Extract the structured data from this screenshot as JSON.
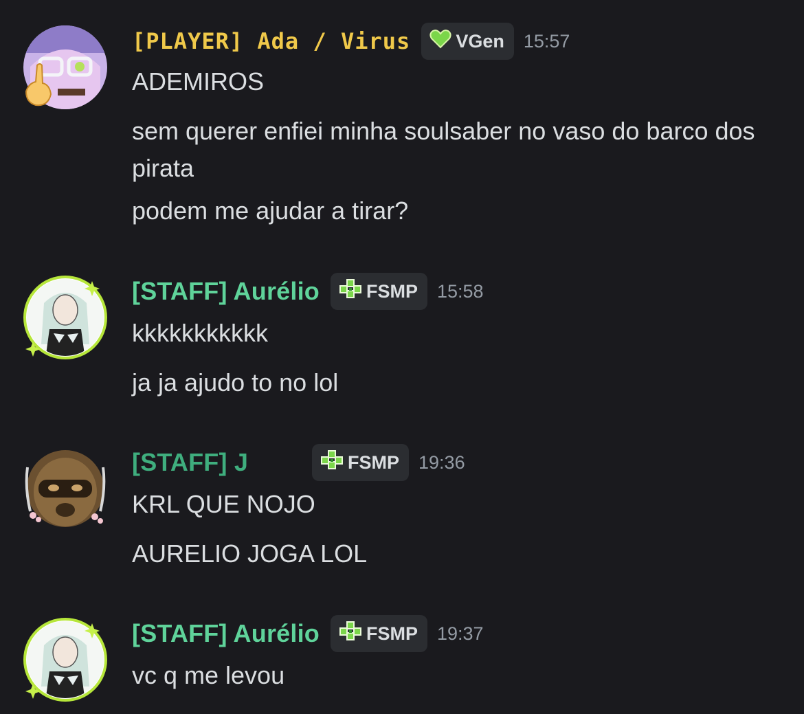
{
  "messages": [
    {
      "username": "[PLAYER] Ada / Virus",
      "name_color": "#f0c94a",
      "tag": "VGen",
      "tag_icon": "green-heart-icon",
      "time": "15:57",
      "lines": [
        "ADEMIROS",
        "sem querer enfiei minha soulsaber no vaso do barco dos pirata",
        "podem me ajudar a tirar?"
      ]
    },
    {
      "username": "[STAFF] Aurélio",
      "name_color": "#5fd39a",
      "tag": "FSMP",
      "tag_icon": "clover-icon",
      "time": "15:58",
      "lines": [
        "kkkkkkkkkkk",
        "ja ja ajudo to no lol"
      ]
    },
    {
      "username": "[STAFF] J",
      "name_color": "#3fae7e",
      "tag": "FSMP",
      "tag_icon": "clover-icon",
      "time": "19:36",
      "lines": [
        "KRL QUE NOJO",
        "AURELIO JOGA LOL"
      ]
    },
    {
      "username": "[STAFF] Aurélio",
      "name_color": "#5fd39a",
      "tag": "FSMP",
      "tag_icon": "clover-icon",
      "time": "19:37",
      "lines": [
        "vc q me levou"
      ]
    }
  ]
}
